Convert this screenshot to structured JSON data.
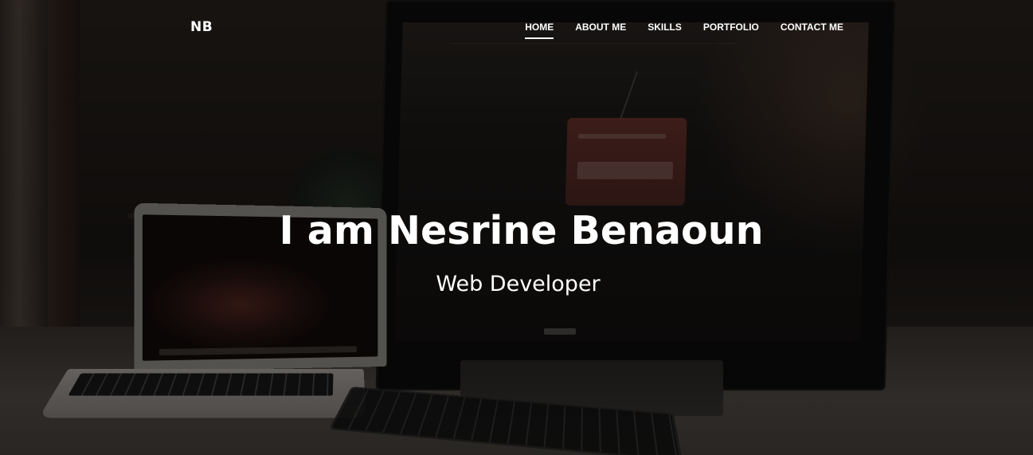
{
  "navbar": {
    "brand": "NB",
    "links": [
      {
        "label": "HOME",
        "active": true
      },
      {
        "label": "ABOUT ME",
        "active": false
      },
      {
        "label": "SKILLS",
        "active": false
      },
      {
        "label": "PORTFOLIO",
        "active": false
      },
      {
        "label": "CONTACT ME",
        "active": false
      }
    ]
  },
  "hero": {
    "title": "I am Nesrine Benaoun",
    "subtitle": "Web Developer"
  },
  "colors": {
    "text": "#ffffff",
    "overlay": "rgba(0,0,0,0.45)"
  }
}
